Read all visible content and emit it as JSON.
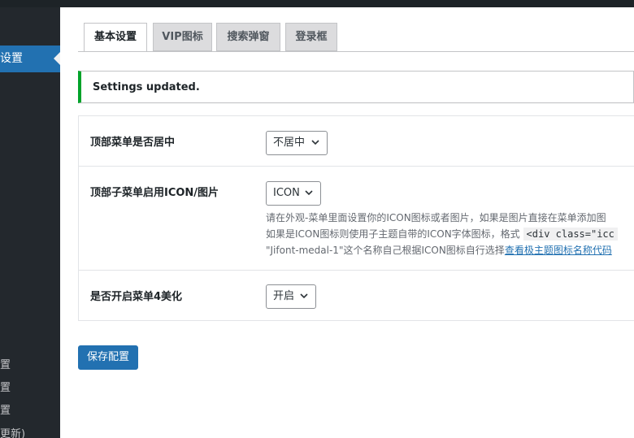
{
  "sidebar": {
    "active_label": "设置",
    "items": [
      {
        "label": "置"
      },
      {
        "label": "置"
      },
      {
        "label": "置"
      },
      {
        "label": "更新)"
      }
    ]
  },
  "tabs": [
    {
      "label": "基本设置",
      "active": true
    },
    {
      "label": "VIP图标",
      "active": false
    },
    {
      "label": "搜索弹窗",
      "active": false
    },
    {
      "label": "登录框",
      "active": false
    }
  ],
  "notice": {
    "text": "Settings updated.",
    "color": "#00a32a"
  },
  "settings": [
    {
      "label": "顶部菜单是否居中",
      "value": "不居中"
    },
    {
      "label": "顶部子菜单启用ICON/图片",
      "value": "ICON",
      "desc_line1": "请在外观-菜单里面设置你的ICON图标或者图片，如果是图片直接在菜单添加图",
      "desc_line2_prefix": "如果是ICON图标则使用子主题自带的ICON字体图标，格式",
      "desc_line2_code": "<div class=\"icc",
      "desc_line3_prefix": "\"Jifont-medal-1\"这个名称自己根据ICON图标自行选择",
      "desc_line3_link": "查看极主题图标名称代码"
    },
    {
      "label": "是否开启菜单4美化",
      "value": "开启"
    }
  ],
  "save_button": "保存配置",
  "colors": {
    "accent": "#2271b1",
    "sidebar": "#23282d",
    "success": "#00a32a"
  }
}
